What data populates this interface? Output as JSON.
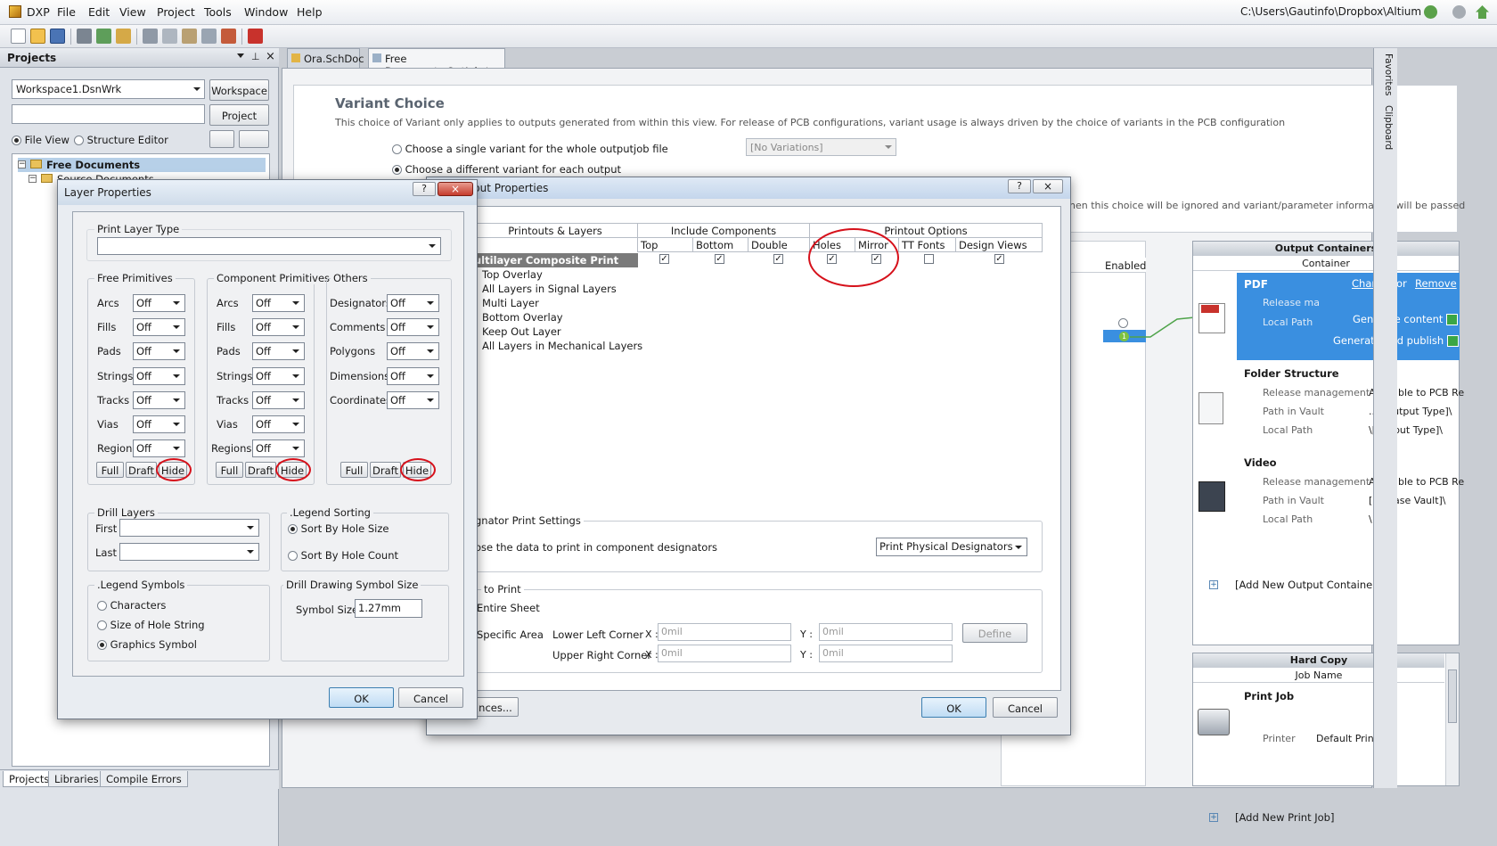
{
  "menubar": {
    "app": "DXP",
    "items": [
      "File",
      "Edit",
      "View",
      "Project",
      "Tools",
      "Window",
      "Help"
    ],
    "path": "C:\\Users\\Gautinfo\\Dropbox\\Altium"
  },
  "projects_panel": {
    "title": "Projects",
    "workspace_combo": "Workspace1.DsnWrk",
    "workspace_button": "Workspace",
    "project_button": "Project",
    "file_view": "File View",
    "structure_editor": "Structure Editor",
    "tree_root": "Free Documents",
    "tree_child": "Source Documents",
    "bottom_tabs": [
      "Projects",
      "Libraries",
      "Compile Errors"
    ]
  },
  "doc_tabs": [
    "Ora.SchDoc",
    "Free Documents.OutJob *"
  ],
  "variant": {
    "title": "Variant Choice",
    "description": "This choice of Variant only applies to outputs generated from within this view. For release of PCB configurations, variant usage is always driven by the choice of variants in the PCB configuration",
    "opt_single": "Choose a single variant for the whole outputjob file",
    "opt_each": "Choose a different variant for each output",
    "variant_combo": "[No Variations]",
    "ignored_note": "hen this choice will be ignored and variant/parameter information will be passed"
  },
  "enabled_header": "Enabled",
  "output_props": {
    "title": "put Properties",
    "col_printouts": "Printouts & Layers",
    "col_include": "Include Components",
    "col_options": "Printout Options",
    "sub_cols": [
      "Top",
      "Bottom",
      "Double Si...",
      "Holes",
      "Mirror",
      "TT Fonts",
      "Design Views"
    ],
    "checks": [
      true,
      true,
      true,
      true,
      true,
      false,
      true
    ],
    "rows": [
      "ultilayer Composite Print",
      "Top Overlay",
      "All Layers in Signal Layers",
      "Multi Layer",
      "Bottom Overlay",
      "Keep Out Layer",
      "All Layers in Mechanical Layers"
    ],
    "designator_group": "gnator Print Settings",
    "designator_text": "ose the data to print in component designators",
    "designator_combo": "Print Physical Designators",
    "area_group": "to Print",
    "entire_sheet": "Entire Sheet",
    "specific_area": "Specific Area",
    "lower_left": "Lower Left Corner",
    "upper_right": "Upper Right Corner",
    "x_label": "X :",
    "y_label": "Y :",
    "zero": "0mil",
    "define": "Define",
    "prefs": "nces...",
    "ok": "OK",
    "cancel": "Cancel"
  },
  "layer_props": {
    "title": "Layer Properties",
    "print_layer_type": "Print Layer Type",
    "free_primitives": "Free Primitives",
    "component_primitives": "Component Primitives",
    "others": "Others",
    "free_rows": [
      "Arcs",
      "Fills",
      "Pads",
      "Strings",
      "Tracks",
      "Vias",
      "Regions"
    ],
    "other_rows": [
      "Designators",
      "Comments",
      "Polygons",
      "Dimensions",
      "Coordinates"
    ],
    "off": "Off",
    "full": "Full",
    "draft": "Draft",
    "hide": "Hide",
    "drill_layers": "Drill Layers",
    "first": "First",
    "last": "Last",
    "legend_sorting": ".Legend Sorting",
    "sort_size": "Sort By Hole Size",
    "sort_count": "Sort By Hole Count",
    "legend_symbols": ".Legend Symbols",
    "characters": "Characters",
    "size_of_hole": "Size of Hole String",
    "graphics_symbol": "Graphics Symbol",
    "drill_symbol_size": "Drill Drawing Symbol Size",
    "symbol_size_label": "Symbol Size",
    "symbol_size_value": "1.27mm",
    "ok": "OK",
    "cancel": "Cancel"
  },
  "containers": {
    "header": "Output Containers",
    "subheader": "Container",
    "pdf": {
      "name": "PDF",
      "change": "Change",
      "or": "or",
      "remove": "Remove",
      "release": "Release ma",
      "local_path": "Local Path",
      "generate": "Generate content",
      "generate_publish": "Generate and publish"
    },
    "folder": {
      "name": "Folder Structure",
      "release_label": "Release management",
      "release_value": "Available to PCB Re",
      "vault_label": "Path in Vault",
      "vault_value": "...\\[Output Type]\\",
      "local_label": "Local Path",
      "local_value": "\\[Output Type]\\"
    },
    "video": {
      "name": "Video",
      "release_label": "Release management",
      "release_value": "Available to PCB Re",
      "vault_label": "Path in Vault",
      "vault_value": "[Release Vault]\\",
      "local_label": "Local Path",
      "local_value": "\\"
    },
    "add_new": "[Add New Output Container]"
  },
  "hardcopy": {
    "header": "Hard Copy",
    "subheader": "Job Name",
    "job": "Print Job",
    "printer_label": "Printer",
    "printer_value": "Default Printer",
    "add_new": "[Add New Print Job]"
  },
  "side_tabs": [
    "Favorites",
    "Clipboard"
  ],
  "enabled_badge": "1"
}
